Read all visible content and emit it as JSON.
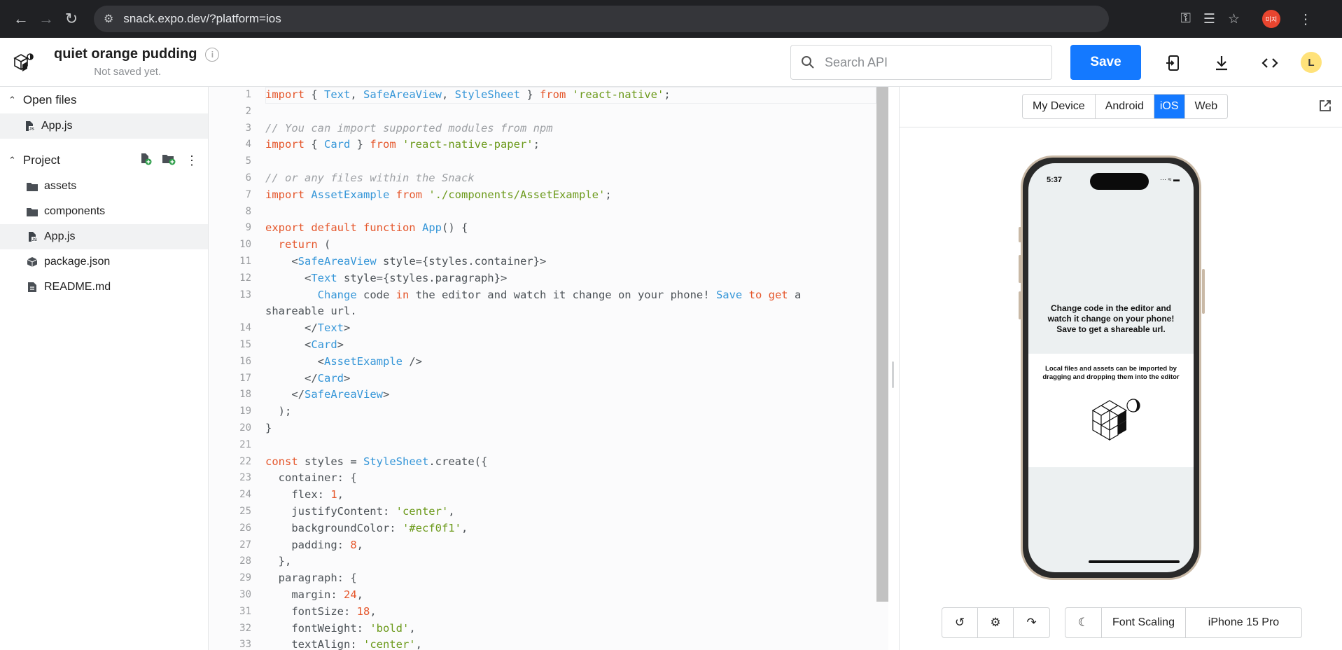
{
  "browser": {
    "url": "snack.expo.dev/?platform=ios",
    "avatar_text": "미지"
  },
  "header": {
    "project_title": "quiet orange pudding",
    "save_status": "Not saved yet.",
    "search_placeholder": "Search API",
    "save_label": "Save",
    "user_initial": "L"
  },
  "sidebar": {
    "open_files_label": "Open files",
    "open_files": [
      "App.js"
    ],
    "project_label": "Project",
    "project_items": [
      {
        "name": "assets",
        "icon": "folder-icon"
      },
      {
        "name": "components",
        "icon": "folder-icon"
      },
      {
        "name": "App.js",
        "icon": "js-file-icon"
      },
      {
        "name": "package.json",
        "icon": "package-icon"
      },
      {
        "name": "README.md",
        "icon": "document-icon"
      }
    ]
  },
  "editor": {
    "lines": [
      {
        "n": "1",
        "html": "<span class='kw'>import</span> { <span class='cl'>Text</span>, <span class='cl'>SafeAreaView</span>, <span class='cl'>StyleSheet</span> } <span class='kw'>from</span> <span class='st'>'react-native'</span>;"
      },
      {
        "n": "2",
        "html": ""
      },
      {
        "n": "3",
        "html": "<span class='cm'>// You can import supported modules from npm</span>"
      },
      {
        "n": "4",
        "html": "<span class='kw'>import</span> { <span class='cl'>Card</span> } <span class='kw'>from</span> <span class='st'>'react-native-paper'</span>;"
      },
      {
        "n": "5",
        "html": ""
      },
      {
        "n": "6",
        "html": "<span class='cm'>// or any files within the Snack</span>"
      },
      {
        "n": "7",
        "html": "<span class='kw'>import</span> <span class='cl'>AssetExample</span> <span class='kw'>from</span> <span class='st'>'./components/AssetExample'</span>;"
      },
      {
        "n": "8",
        "html": ""
      },
      {
        "n": "9",
        "html": "<span class='kw'>export default function</span> <span class='cl'>App</span>() {"
      },
      {
        "n": "10",
        "html": "  <span class='kw'>return</span> ("
      },
      {
        "n": "11",
        "html": "    &lt;<span class='cl'>SafeAreaView</span> style={styles.container}&gt;"
      },
      {
        "n": "12",
        "html": "      &lt;<span class='cl'>Text</span> style={styles.paragraph}&gt;"
      },
      {
        "n": "13",
        "html": "        <span class='cl'>Change</span> code <span class='kw'>in</span> the editor and watch it change on your phone! <span class='cl'>Save</span> <span class='kw'>to</span> <span class='kw'>get</span> a",
        "wrap": "shareable url."
      },
      {
        "n": "14",
        "html": "      &lt;/<span class='cl'>Text</span>&gt;"
      },
      {
        "n": "15",
        "html": "      &lt;<span class='cl'>Card</span>&gt;"
      },
      {
        "n": "16",
        "html": "        &lt;<span class='cl'>AssetExample</span> /&gt;"
      },
      {
        "n": "17",
        "html": "      &lt;/<span class='cl'>Card</span>&gt;"
      },
      {
        "n": "18",
        "html": "    &lt;/<span class='cl'>SafeAreaView</span>&gt;"
      },
      {
        "n": "19",
        "html": "  );"
      },
      {
        "n": "20",
        "html": "}"
      },
      {
        "n": "21",
        "html": ""
      },
      {
        "n": "22",
        "html": "<span class='kw'>const</span> styles = <span class='cl'>StyleSheet</span>.create({"
      },
      {
        "n": "23",
        "html": "  container: {"
      },
      {
        "n": "24",
        "html": "    flex: <span class='nm'>1</span>,"
      },
      {
        "n": "25",
        "html": "    justifyContent: <span class='st'>'center'</span>,"
      },
      {
        "n": "26",
        "html": "    backgroundColor: <span class='st'>'#ecf0f1'</span>,"
      },
      {
        "n": "27",
        "html": "    padding: <span class='nm'>8</span>,"
      },
      {
        "n": "28",
        "html": "  },"
      },
      {
        "n": "29",
        "html": "  paragraph: {"
      },
      {
        "n": "30",
        "html": "    margin: <span class='nm'>24</span>,"
      },
      {
        "n": "31",
        "html": "    fontSize: <span class='nm'>18</span>,"
      },
      {
        "n": "32",
        "html": "    fontWeight: <span class='st'>'bold'</span>,"
      },
      {
        "n": "33",
        "html": "    textAlign: <span class='st'>'center'</span>,"
      }
    ]
  },
  "preview": {
    "platform_tabs": [
      "My Device",
      "Android",
      "iOS",
      "Web"
    ],
    "selected_platform": "iOS",
    "phone_time": "5:37",
    "paragraph": "Change code in the editor and watch it change on your phone! Save to get a shareable url.",
    "card_text": "Local files and assets can be imported by dragging and dropping them into the editor",
    "font_scaling_label": "Font Scaling",
    "device_label": "iPhone 15 Pro"
  },
  "colors": {
    "accent": "#1479ff",
    "keyword": "#e5572c",
    "string": "#6c9a1b",
    "class": "#3596d8"
  }
}
